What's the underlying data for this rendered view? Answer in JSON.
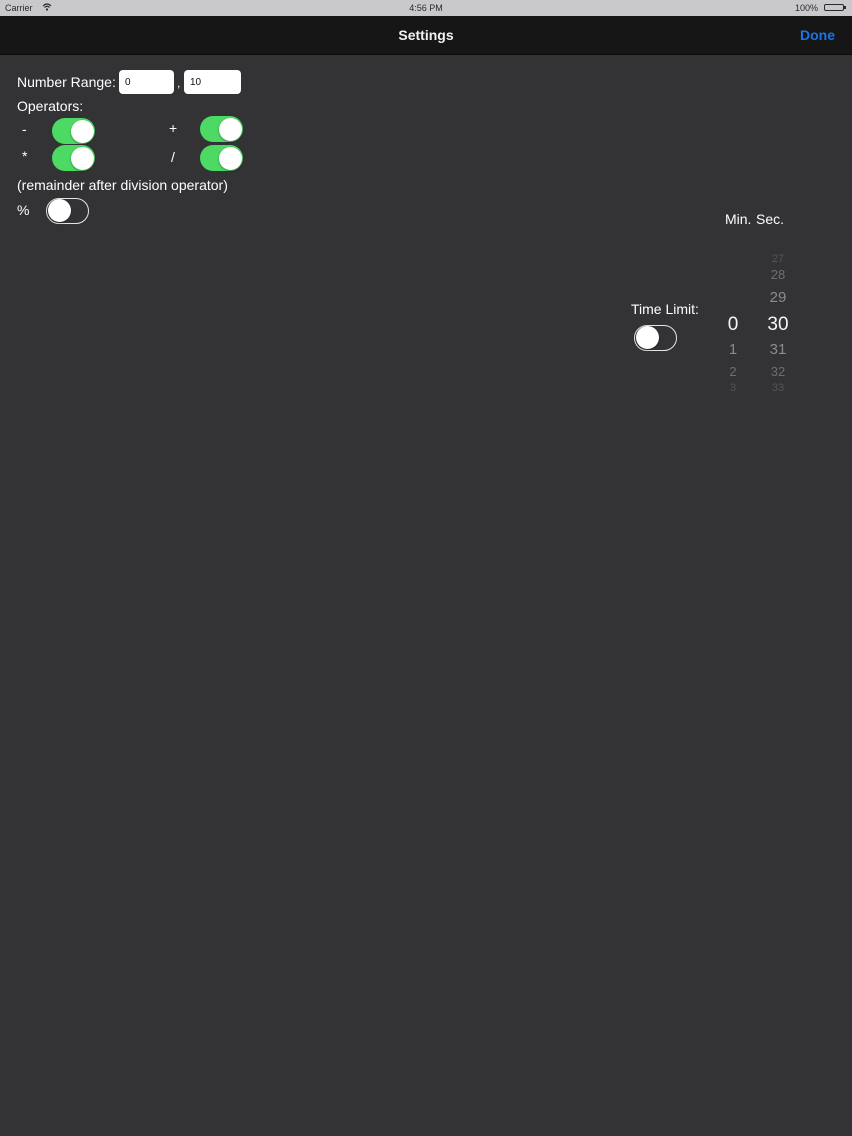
{
  "status_bar": {
    "carrier": "Carrier",
    "time": "4:56 PM",
    "battery": "100%"
  },
  "nav": {
    "title": "Settings",
    "done_label": "Done"
  },
  "range": {
    "label": "Number Range:",
    "separator": ",",
    "min_value": "0",
    "max_value": "10"
  },
  "operators": {
    "label": "Operators:",
    "minus_symbol": "-",
    "minus_on": true,
    "plus_symbol": "+",
    "plus_on": true,
    "multiply_symbol": "*",
    "multiply_on": true,
    "divide_symbol": "/",
    "divide_on": true,
    "remainder_note": "(remainder after division operator)",
    "modulo_symbol": "%",
    "modulo_on": false
  },
  "time_limit": {
    "label": "Time Limit:",
    "enabled": false
  },
  "picker": {
    "min_header": "Min.",
    "sec_header": "Sec.",
    "minutes": [
      "0",
      "1",
      "2",
      "3"
    ],
    "selected_minute": "0",
    "seconds": [
      "27",
      "28",
      "29",
      "30",
      "31",
      "32",
      "33"
    ],
    "selected_second": "30"
  },
  "colors": {
    "background": "#333235",
    "nav_background": "#161617",
    "toggle_on": "#4cd964",
    "done_blue": "#1a74e8"
  }
}
